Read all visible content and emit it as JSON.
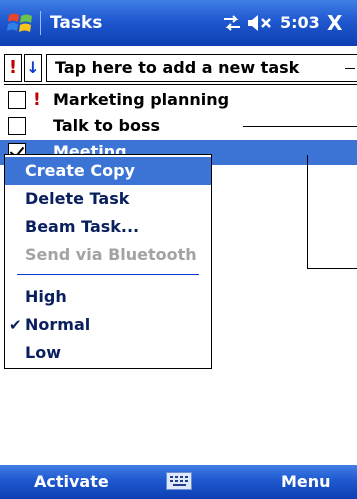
{
  "title_bar": {
    "title": "Tasks",
    "time": "5:03",
    "close": "X",
    "icons": [
      "windows-start-icon",
      "connectivity-icon",
      "volume-muted-icon"
    ]
  },
  "new_task_bar": {
    "priority_glyph": "!",
    "sort_glyph": "↓",
    "placeholder": "Tap here to add a new task"
  },
  "tasks": [
    {
      "label": "Marketing planning",
      "checked": false,
      "priority": "!"
    },
    {
      "label": "Talk to boss",
      "checked": false,
      "priority": ""
    },
    {
      "label": "Meeting",
      "checked": true,
      "priority": ""
    }
  ],
  "context_menu": {
    "items": [
      "Create Copy",
      "Delete Task",
      "Beam Task...",
      "Send via Bluetooth"
    ],
    "priority_items": [
      "High",
      "Normal",
      "Low"
    ],
    "selected_priority": "Normal",
    "check_glyph": "✔"
  },
  "soft_keys": {
    "left": "Activate",
    "right": "Menu",
    "icons": [
      "keyboard-icon"
    ]
  },
  "colors": {
    "title_bar": "#1f58cf",
    "highlight": "#3c74d6",
    "priority_red": "#c00000",
    "disabled_text": "#a3a3a3"
  }
}
